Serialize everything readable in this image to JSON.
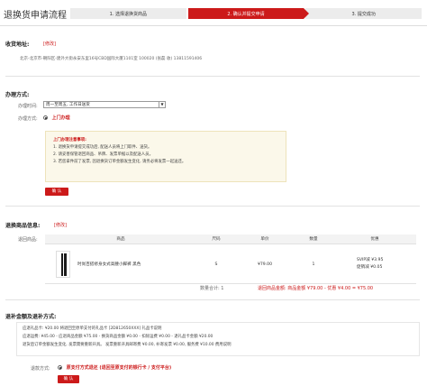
{
  "page_title": "退换货申请流程",
  "steps": [
    {
      "label": "1. 选择退换货商品",
      "active": false
    },
    {
      "label": "2. 确认并提交申请",
      "active": true
    },
    {
      "label": "3. 提交成功",
      "active": false
    }
  ],
  "address": {
    "heading": "收货地址:",
    "modify_link": "[修改]",
    "text": "北京-北京市-朝阳区-建外大街永安东里16号CBD国际大厦1101室  100020  (张磊 收)  13811591406"
  },
  "method": {
    "heading": "办理方式:",
    "time_label": "办理时间:",
    "time_value": "周一至周五, 工作日送货",
    "type_label": "办理方式:",
    "type_value": "上门办理",
    "notice_title": "上门办理注意事项:",
    "notice_lines": [
      "1. 退换货申请提交成功后, 配送人员将上门取件、送货。",
      "2. 请妥善保管退回商品、吊牌、发票单据以及配送人员。",
      "3. 若您拿件前了发票, 因退换货订单金额发生变化, 请务必将发票一起送还。"
    ],
    "confirm_button": "确 认"
  },
  "products": {
    "heading": "退换商品信息:",
    "modify_link": "[修改]",
    "row_label": "退回商品:",
    "columns": [
      "商品",
      "尺码",
      "单价",
      "数量",
      "优惠"
    ],
    "rows": [
      {
        "name": "时尚百搭修身女式高腰小脚裤 黑色",
        "size": "S",
        "price": "¥79.00",
        "qty": "1",
        "promo1": "SVIP减 ¥3.95",
        "promo2": "促销减 ¥0.05"
      }
    ],
    "summary_count": "数量合计: 1",
    "summary_total": "退回商品金额: 商品金额 ¥79.00 - 优惠 ¥4.00 = ¥75.00"
  },
  "refund": {
    "heading": "退补金额及退补方式:",
    "lines": [
      "应退礼品卡: ¥20.00   将退回至原单支付的礼品卡 [2D812650XXX]   礼品卡说明",
      "应退运费: ¥45.00 - 应退商品金额 ¥75.00 - 换货商品金额 ¥0.00 - 扣除运费 ¥0.00 - 退礼品卡金额 ¥20.00",
      "退货后订单金额发生变化, 发票需要重新开具。   发票重新开具邮寄费 ¥0.00, 补寄发票 ¥0.00, 服务费 ¥10.00   费用说明"
    ],
    "method_label": "退款方式:",
    "method_value": "原支付方式退还 (退回至原支付的银行卡 / 支付平台)",
    "confirm_button": "确 认"
  },
  "colors": {
    "accent": "#cc1a1a",
    "notice_bg": "#fbf8ea"
  }
}
